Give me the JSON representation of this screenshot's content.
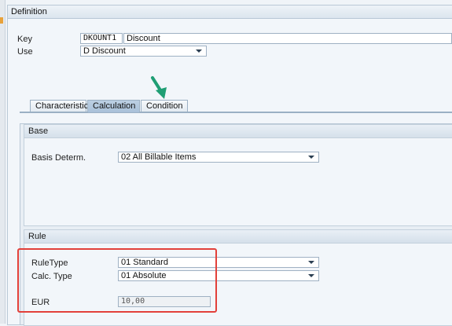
{
  "section": {
    "title": "Definition"
  },
  "key": {
    "label": "Key",
    "code": "DKOUNT1",
    "name": "Discount"
  },
  "use": {
    "label": "Use",
    "value": "D Discount"
  },
  "tabs": [
    {
      "label": "Characteristics",
      "active": false
    },
    {
      "label": "Calculation",
      "active": true
    },
    {
      "label": "Condition",
      "active": false
    }
  ],
  "base": {
    "title": "Base",
    "basis_label": "Basis Determ.",
    "basis_value": "02 All Billable Items"
  },
  "rule": {
    "title": "Rule",
    "ruletype_label": "RuleType",
    "ruletype_value": "01 Standard",
    "calctype_label": "Calc. Type",
    "calctype_value": "01 Absolute",
    "currency_label": "EUR",
    "amount_value": "10,00"
  },
  "colors": {
    "highlight_box": "#e2403a",
    "pointer_arrow": "#1f9e74",
    "active_tab": "#a9c1d9"
  },
  "icons": [
    "dropdown-arrow-icon",
    "pointer-arrow-icon"
  ]
}
